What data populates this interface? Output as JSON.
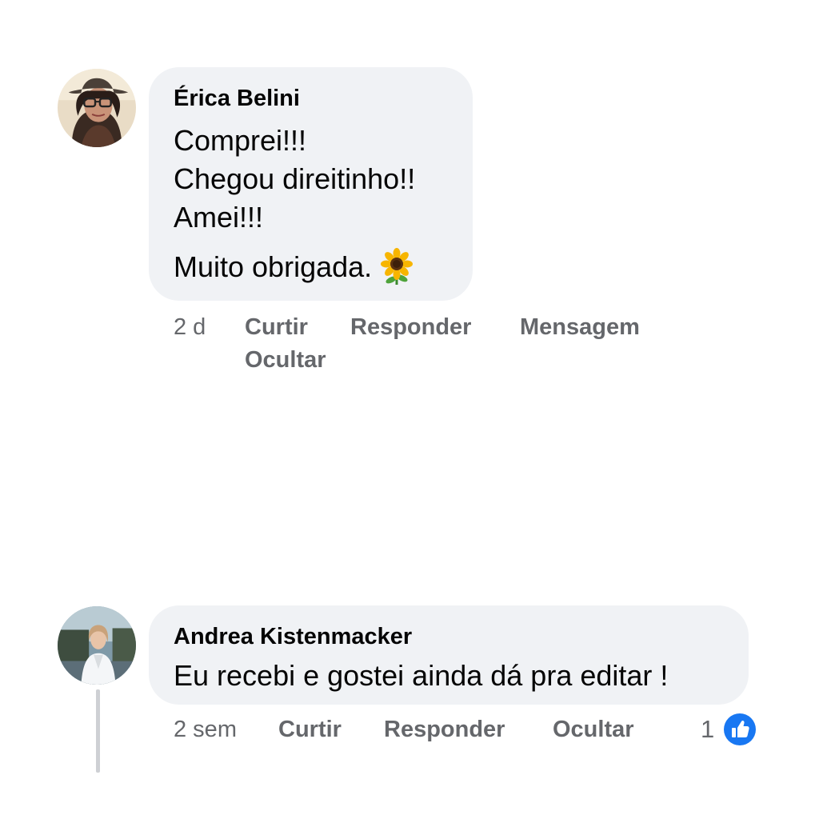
{
  "comments": [
    {
      "author": "Érica Belini",
      "lines": [
        "Comprei!!!",
        "Chegou direitinho!!",
        "Amei!!!",
        "Muito obrigada."
      ],
      "emoji": "sunflower-icon",
      "time": "2 d",
      "actions": {
        "like": "Curtir",
        "reply": "Responder",
        "message": "Mensagem",
        "hide": "Ocultar"
      }
    },
    {
      "author": "Andrea Kistenmacker",
      "text": "Eu recebi e gostei ainda dá pra editar !",
      "time": "2 sem",
      "actions": {
        "like": "Curtir",
        "reply": "Responder",
        "hide": "Ocultar"
      },
      "reaction_count": "1",
      "reaction_icon": "thumbs-up-icon",
      "reaction_color": "#1877f2"
    }
  ]
}
